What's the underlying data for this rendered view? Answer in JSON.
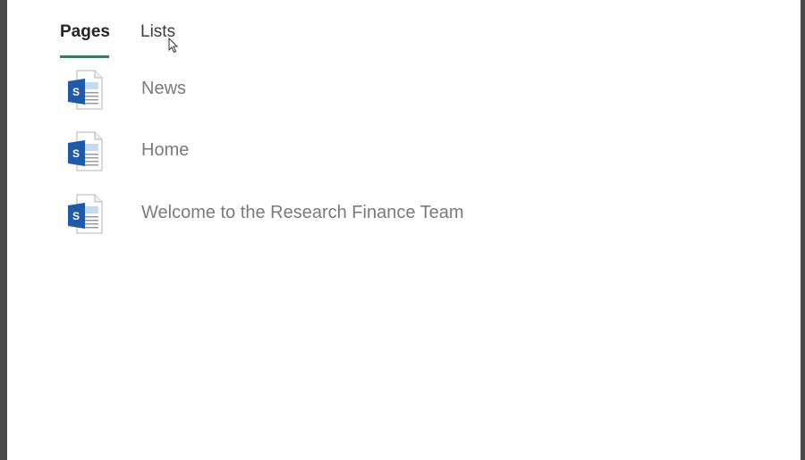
{
  "tabs": {
    "pages_label": "Pages",
    "lists_label": "Lists",
    "active": "Pages"
  },
  "pages": [
    {
      "title": "News",
      "icon": "sharepoint-page-icon"
    },
    {
      "title": "Home",
      "icon": "sharepoint-page-icon"
    },
    {
      "title": "Welcome to the Research Finance Team",
      "icon": "sharepoint-page-icon"
    }
  ],
  "colors": {
    "tab_underline": "#3d7a5a",
    "sharepoint_blue": "#1e5aa8",
    "page_title": "#7b7b7b"
  }
}
